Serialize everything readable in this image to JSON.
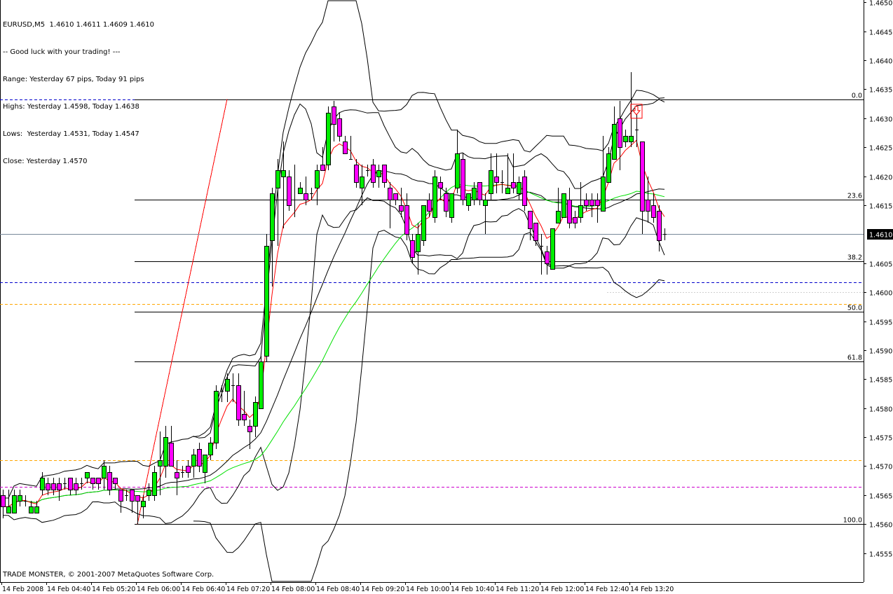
{
  "header": {
    "symbol_line": "EURUSD,M5  1.4610 1.4611 1.4609 1.4610",
    "info_lines": [
      "-- Good luck with your trading! ---",
      "Range: Yesterday 67 pips, Today 91 pips",
      "Highs: Yesterday 1.4598, Today 1.4638",
      "Lows:  Yesterday 1.4531, Today 1.4547",
      "Close: Yesterday 1.4570"
    ]
  },
  "footer": {
    "copyright": "TRADE MONSTER, © 2001-2007 MetaQuotes Software Corp."
  },
  "colors": {
    "bull": "#00ee00",
    "bear": "#ff00ff",
    "fast_ma": "#ff0000",
    "slow_ma": "#00e000",
    "bands": "#000000",
    "bid_line": "#778899",
    "trendline": "#ff0000"
  },
  "chart_data": {
    "type": "candlestick",
    "symbol": "EURUSD",
    "timeframe": "M5",
    "ylim": [
      1.455,
      1.46504
    ],
    "y_ticks": [
      "1.4650",
      "1.4645",
      "1.4640",
      "1.4635",
      "1.4630",
      "1.4625",
      "1.4620",
      "1.4615",
      "1.4605",
      "1.4600",
      "1.4595",
      "1.4590",
      "1.4585",
      "1.4580",
      "1.4575",
      "1.4570",
      "1.4565",
      "1.4560",
      "1.4555"
    ],
    "current_price": "1.4610",
    "x_labels": [
      {
        "bar": 0,
        "label": "14 Feb 2008"
      },
      {
        "bar": 8,
        "label": "14 Feb 04:40"
      },
      {
        "bar": 16,
        "label": "14 Feb 05:20"
      },
      {
        "bar": 24,
        "label": "14 Feb 06:00"
      },
      {
        "bar": 32,
        "label": "14 Feb 06:40"
      },
      {
        "bar": 40,
        "label": "14 Feb 07:20"
      },
      {
        "bar": 48,
        "label": "14 Feb 08:00"
      },
      {
        "bar": 56,
        "label": "14 Feb 08:40"
      },
      {
        "bar": 64,
        "label": "14 Feb 09:20"
      },
      {
        "bar": 72,
        "label": "14 Feb 10:00"
      },
      {
        "bar": 80,
        "label": "14 Feb 10:40"
      },
      {
        "bar": 88,
        "label": "14 Feb 11:20"
      },
      {
        "bar": 96,
        "label": "14 Feb 12:00"
      },
      {
        "bar": 104,
        "label": "14 Feb 12:40"
      },
      {
        "bar": 112,
        "label": "14 Feb 13:20"
      }
    ],
    "ohlc": [
      [
        1.4565,
        1.4566,
        1.4561,
        1.4563
      ],
      [
        1.4562,
        1.4566,
        1.4562,
        1.4563
      ],
      [
        1.4562,
        1.4566,
        1.4562,
        1.4565
      ],
      [
        1.4564,
        1.4566,
        1.4563,
        1.4565
      ],
      [
        1.4564,
        1.4565,
        1.4563,
        1.4564
      ],
      [
        1.4562,
        1.4564,
        1.4562,
        1.4563
      ],
      [
        1.4562,
        1.4564,
        1.4562,
        1.4563
      ],
      [
        1.4566,
        1.4569,
        1.4565,
        1.4568
      ],
      [
        1.4567,
        1.4568,
        1.4565,
        1.4566
      ],
      [
        1.4567,
        1.4568,
        1.4565,
        1.4566
      ],
      [
        1.4567,
        1.4568,
        1.4564,
        1.4566
      ],
      [
        1.4567,
        1.4568,
        1.4566,
        1.4567
      ],
      [
        1.4568,
        1.4568,
        1.4565,
        1.4566
      ],
      [
        1.4567,
        1.4568,
        1.4565,
        1.4566
      ],
      [
        1.4567,
        1.4568,
        1.4566,
        1.4567
      ],
      [
        1.4568,
        1.4569,
        1.4567,
        1.4569
      ],
      [
        1.4568,
        1.4568,
        1.4566,
        1.4567
      ],
      [
        1.4568,
        1.4568,
        1.4566,
        1.4567
      ],
      [
        1.4568,
        1.4571,
        1.4566,
        1.457
      ],
      [
        1.4569,
        1.457,
        1.4565,
        1.4566
      ],
      [
        1.4568,
        1.4568,
        1.4566,
        1.4567
      ],
      [
        1.4566,
        1.4566,
        1.4562,
        1.4564
      ],
      [
        1.4565,
        1.4566,
        1.4564,
        1.4565
      ],
      [
        1.4566,
        1.4566,
        1.4562,
        1.4564
      ],
      [
        1.4565,
        1.4565,
        1.456,
        1.4564
      ],
      [
        1.4563,
        1.4565,
        1.4561,
        1.4564
      ],
      [
        1.4565,
        1.4567,
        1.4564,
        1.4566
      ],
      [
        1.4565,
        1.457,
        1.4564,
        1.4569
      ],
      [
        1.457,
        1.4576,
        1.4565,
        1.4571
      ],
      [
        1.457,
        1.4577,
        1.4568,
        1.4575
      ],
      [
        1.4574,
        1.4577,
        1.457,
        1.457
      ],
      [
        1.4569,
        1.4571,
        1.4565,
        1.4568
      ],
      [
        1.4569,
        1.457,
        1.4568,
        1.4569
      ],
      [
        1.457,
        1.4571,
        1.4568,
        1.4569
      ],
      [
        1.457,
        1.4573,
        1.4568,
        1.4572
      ],
      [
        1.4573,
        1.4574,
        1.4569,
        1.457
      ],
      [
        1.4569,
        1.4572,
        1.4567,
        1.4572
      ],
      [
        1.4572,
        1.4575,
        1.4571,
        1.4574
      ],
      [
        1.4574,
        1.4584,
        1.4573,
        1.4583
      ],
      [
        1.4583,
        1.4584,
        1.4581,
        1.4583
      ],
      [
        1.4583,
        1.4586,
        1.4581,
        1.4585
      ],
      [
        1.4584,
        1.4586,
        1.4581,
        1.4584
      ],
      [
        1.4584,
        1.4586,
        1.4577,
        1.4578
      ],
      [
        1.4579,
        1.4583,
        1.4577,
        1.4578
      ],
      [
        1.4577,
        1.4578,
        1.4573,
        1.4576
      ],
      [
        1.4577,
        1.4582,
        1.4575,
        1.4581
      ],
      [
        1.458,
        1.4589,
        1.458,
        1.4588
      ],
      [
        1.4589,
        1.461,
        1.4588,
        1.4608
      ],
      [
        1.4609,
        1.4618,
        1.4601,
        1.4617
      ],
      [
        1.4618,
        1.4623,
        1.4608,
        1.4621
      ],
      [
        1.462,
        1.4626,
        1.4611,
        1.4621
      ],
      [
        1.462,
        1.4621,
        1.4614,
        1.4615
      ],
      [
        1.4616,
        1.4622,
        1.4613,
        1.4616
      ],
      [
        1.4617,
        1.4619,
        1.4617,
        1.4618
      ],
      [
        1.4617,
        1.462,
        1.4615,
        1.4616
      ],
      [
        1.4617,
        1.4618,
        1.4616,
        1.4617
      ],
      [
        1.4618,
        1.4622,
        1.4615,
        1.4621
      ],
      [
        1.4622,
        1.4625,
        1.4621,
        1.4621
      ],
      [
        1.4622,
        1.4632,
        1.4621,
        1.4631
      ],
      [
        1.4632,
        1.4633,
        1.4626,
        1.4629
      ],
      [
        1.463,
        1.4631,
        1.4626,
        1.4627
      ],
      [
        1.4626,
        1.4627,
        1.4624,
        1.4624
      ],
      [
        1.4623,
        1.4627,
        1.4623,
        1.4623
      ],
      [
        1.4622,
        1.4623,
        1.4618,
        1.4619
      ],
      [
        1.4618,
        1.4622,
        1.4615,
        1.462
      ],
      [
        1.4621,
        1.4622,
        1.462,
        1.4621
      ],
      [
        1.4622,
        1.4623,
        1.4618,
        1.4619
      ],
      [
        1.462,
        1.4622,
        1.4618,
        1.4621
      ],
      [
        1.4622,
        1.4622,
        1.4618,
        1.4619
      ],
      [
        1.4618,
        1.4619,
        1.4611,
        1.4616
      ],
      [
        1.4617,
        1.4617,
        1.4615,
        1.4616
      ],
      [
        1.4615,
        1.4618,
        1.4613,
        1.4614
      ],
      [
        1.4615,
        1.4617,
        1.4609,
        1.461
      ],
      [
        1.4609,
        1.461,
        1.4605,
        1.4606
      ],
      [
        1.4607,
        1.4612,
        1.4603,
        1.461
      ],
      [
        1.4609,
        1.4615,
        1.4608,
        1.4615
      ],
      [
        1.4616,
        1.4617,
        1.4613,
        1.4614
      ],
      [
        1.4613,
        1.4621,
        1.4612,
        1.462
      ],
      [
        1.4619,
        1.462,
        1.4616,
        1.4618
      ],
      [
        1.4617,
        1.4618,
        1.4613,
        1.4614
      ],
      [
        1.4613,
        1.4617,
        1.4612,
        1.4617
      ],
      [
        1.4618,
        1.4628,
        1.4617,
        1.4624
      ],
      [
        1.4623,
        1.4624,
        1.4615,
        1.4616
      ],
      [
        1.4615,
        1.4617,
        1.4614,
        1.4617
      ],
      [
        1.4616,
        1.4619,
        1.4615,
        1.4618
      ],
      [
        1.4619,
        1.4619,
        1.4615,
        1.4616
      ],
      [
        1.4615,
        1.4617,
        1.461,
        1.4616
      ],
      [
        1.4617,
        1.4624,
        1.4616,
        1.4621
      ],
      [
        1.462,
        1.4624,
        1.4617,
        1.4619
      ],
      [
        1.4619,
        1.4621,
        1.4617,
        1.4619
      ],
      [
        1.4617,
        1.4624,
        1.4617,
        1.4618
      ],
      [
        1.4619,
        1.4624,
        1.4617,
        1.4618
      ],
      [
        1.4617,
        1.462,
        1.4616,
        1.4619
      ],
      [
        1.462,
        1.4621,
        1.4614,
        1.4615
      ],
      [
        1.4614,
        1.4614,
        1.4609,
        1.4611
      ],
      [
        1.4612,
        1.4612,
        1.4608,
        1.4609
      ],
      [
        1.4608,
        1.461,
        1.4603,
        1.4608
      ],
      [
        1.4607,
        1.4608,
        1.4603,
        1.4605
      ],
      [
        1.4604,
        1.4611,
        1.4604,
        1.4611
      ],
      [
        1.4612,
        1.4618,
        1.4612,
        1.4614
      ],
      [
        1.4613,
        1.4617,
        1.4613,
        1.4617
      ],
      [
        1.4616,
        1.4618,
        1.4611,
        1.4612
      ],
      [
        1.4613,
        1.4614,
        1.4611,
        1.4612
      ],
      [
        1.4613,
        1.4619,
        1.4612,
        1.4615
      ],
      [
        1.4616,
        1.4617,
        1.4614,
        1.4615
      ],
      [
        1.4616,
        1.4617,
        1.4613,
        1.4615
      ],
      [
        1.4616,
        1.4617,
        1.4612,
        1.4615
      ],
      [
        1.4614,
        1.4627,
        1.4614,
        1.462
      ],
      [
        1.4619,
        1.4625,
        1.4619,
        1.4624
      ],
      [
        1.4623,
        1.4632,
        1.4623,
        1.4629
      ],
      [
        1.463,
        1.4633,
        1.4621,
        1.4625
      ],
      [
        1.4626,
        1.4628,
        1.4625,
        1.4627
      ],
      [
        1.4626,
        1.4638,
        1.4625,
        1.4627
      ],
      [
        1.4628,
        1.4631,
        1.4625,
        1.4628
      ],
      [
        1.4626,
        1.4626,
        1.461,
        1.4614
      ],
      [
        1.4616,
        1.462,
        1.4612,
        1.4614
      ],
      [
        1.4615,
        1.4617,
        1.4612,
        1.4613
      ],
      [
        1.4614,
        1.4615,
        1.4607,
        1.4609
      ],
      [
        1.461,
        1.4611,
        1.4609,
        1.461
      ]
    ],
    "indicators": {
      "fast_ema_period": 5,
      "middle_sma_period": 20,
      "slow_sma_period": 34,
      "narrow_bands": {
        "period": 10,
        "deviation": 1.5
      },
      "wide_bands": {
        "period": 20,
        "deviation": 2.5,
        "from_bar": 34
      }
    },
    "fibonacci": {
      "start_bar": 24,
      "price_100": 1.456,
      "price_0": 1.46333,
      "levels": [
        {
          "ratio": 0.0,
          "label": "0.0"
        },
        {
          "ratio": 0.236,
          "label": "23.6"
        },
        {
          "ratio": 0.382,
          "label": "38.2"
        },
        {
          "ratio": 0.5,
          "label": "50.0"
        },
        {
          "ratio": 0.618,
          "label": "61.8"
        },
        {
          "ratio": 1.0,
          "label": "100.0"
        }
      ],
      "trendline": {
        "from_bar": 24,
        "from_price": 1.456,
        "to_bar": 40,
        "to_price": 1.46333
      }
    },
    "dashed_levels": [
      {
        "price": 1.46333,
        "color": "#0000cc"
      },
      {
        "price": 1.46017,
        "color": "#0000cc"
      },
      {
        "price": 1.4598,
        "color": "#ffa500"
      },
      {
        "price": 1.4571,
        "color": "#ffa500"
      },
      {
        "price": 1.45664,
        "color": "#cc00cc"
      }
    ],
    "sell_arrow": {
      "bar": 113,
      "price": 1.463
    }
  }
}
